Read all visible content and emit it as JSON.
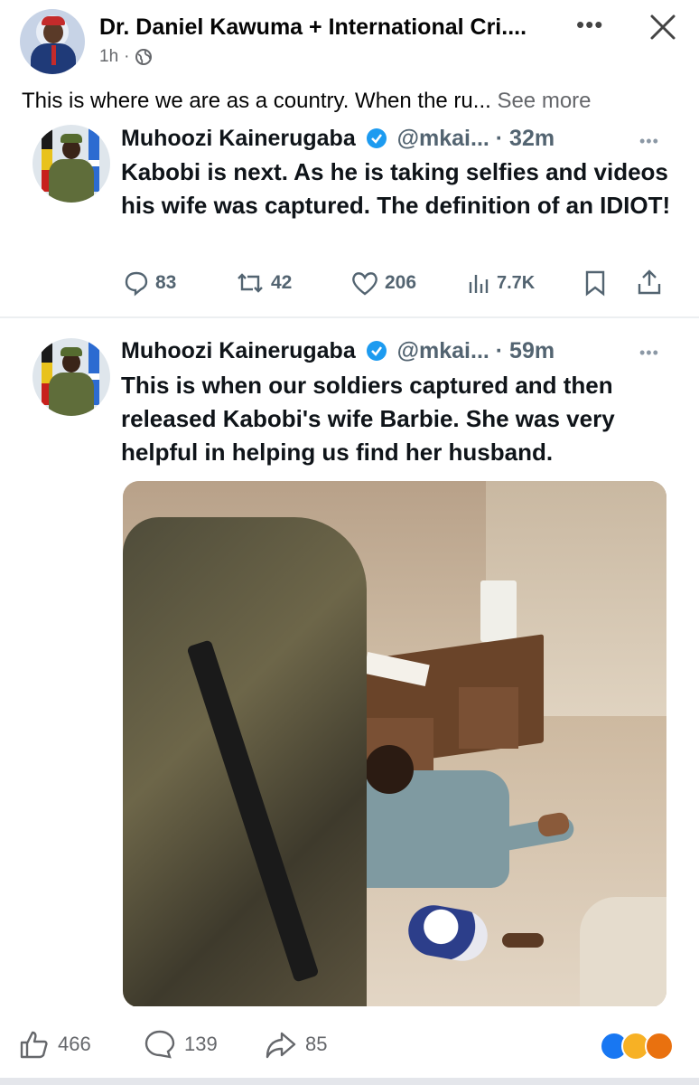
{
  "post": {
    "author": "Dr. Daniel Kawuma + International Cri....",
    "time": "1h",
    "time_sep": "·",
    "text": "This is where we are as a country. When the ru...",
    "see_more": "See more",
    "more_glyph": "•••"
  },
  "embedded": {
    "tweets": [
      {
        "name": "Muhoozi Kainerugaba",
        "handle": "@mkai... · 32m",
        "more": "•••",
        "body": "Kabobi is next. As he is taking selfies and videos his wife was captured. The definition of an IDIOT!",
        "replies": "83",
        "retweets": "42",
        "likes": "206",
        "views": "7.7K"
      },
      {
        "name": "Muhoozi Kainerugaba",
        "handle": "@mkai... · 59m",
        "more": "•••",
        "body": "This is when our soldiers captured and then released Kabobi's wife Barbie. She was very helpful in helping us find her husband."
      }
    ]
  },
  "footer": {
    "likes": "466",
    "comments": "139",
    "shares": "85"
  },
  "colors": {
    "verified": "#1d9bf0",
    "fb_like": "#1877f2",
    "angry": "#e9710f"
  }
}
